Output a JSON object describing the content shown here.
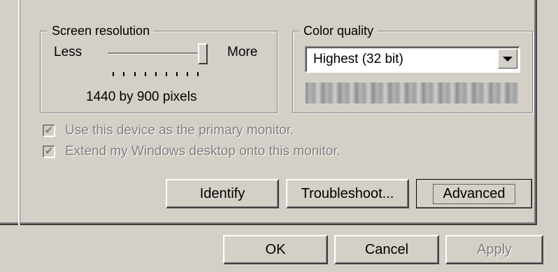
{
  "screen_resolution": {
    "group_label": "Screen resolution",
    "less_label": "Less",
    "more_label": "More",
    "value_label": "1440 by 900 pixels",
    "slider_level": 1.0
  },
  "color_quality": {
    "group_label": "Color quality",
    "selected": "Highest (32 bit)"
  },
  "checkboxes": [
    {
      "label": "Use this device as the primary monitor.",
      "checked": true,
      "enabled": false
    },
    {
      "label": "Extend my Windows desktop onto this monitor.",
      "checked": true,
      "enabled": false
    }
  ],
  "buttons": {
    "identify": "Identify",
    "troubleshoot": "Troubleshoot...",
    "advanced": "Advanced",
    "ok": "OK",
    "cancel": "Cancel",
    "apply": "Apply"
  },
  "icons": {
    "checkmark": "check-icon",
    "dropdown": "chevron-down-icon"
  },
  "colors": {
    "face": "#d4d0c8",
    "shadow": "#808080",
    "highlight": "#ffffff"
  }
}
